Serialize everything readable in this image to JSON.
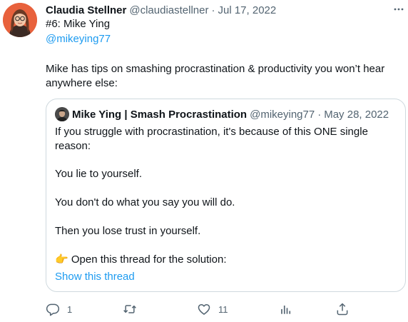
{
  "tweet": {
    "author_name": "Claudia Stellner",
    "author_handle": "@claudiastellner",
    "separator": "·",
    "date": "Jul 17, 2022",
    "line1": "#6: Mike Ying",
    "mention": "@mikeying77",
    "body_line1": "Mike has tips on smashing procrastination & productivity you won’t hear",
    "body_line2": "anywhere else:"
  },
  "quote": {
    "author_name": "Mike Ying | Smash Procrastination",
    "author_handle": "@mikeying77",
    "separator": "·",
    "date": "May 28, 2022",
    "line1": "If you struggle with procrastination, it's because of this ONE single",
    "line2": "reason:",
    "line3": "You lie to yourself.",
    "line4": "You don't do what you say you will do.",
    "line5": "Then you lose trust in yourself.",
    "emoji": "👉",
    "line6": "Open this thread for the solution:",
    "show_thread": "Show this thread"
  },
  "actions": {
    "reply_count": "1",
    "retweet_count": "",
    "like_count": "11"
  },
  "icons": {
    "more": "more-icon",
    "reply": "reply-icon",
    "retweet": "retweet-icon",
    "like": "like-icon",
    "analytics": "analytics-icon",
    "share": "share-icon"
  },
  "colors": {
    "link": "#1d9bf0",
    "secondary_text": "#536471",
    "border": "#cfd9de",
    "avatar_bg": "#e8613c"
  }
}
